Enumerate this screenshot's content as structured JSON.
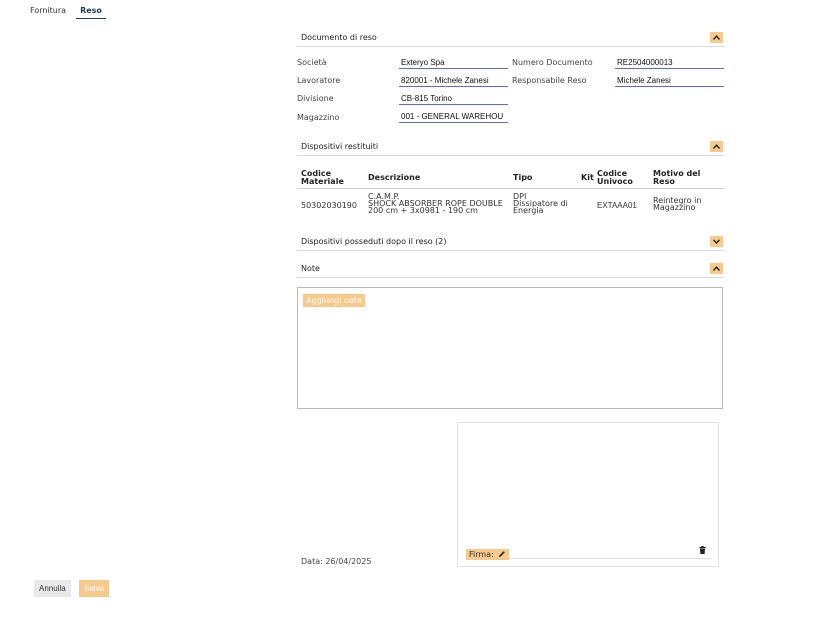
{
  "tabs": [
    {
      "label": "Fornitura",
      "active": false
    },
    {
      "label": "Reso",
      "active": true
    }
  ],
  "document": {
    "title": "Documento di reso",
    "fields": {
      "societa_label": "Società",
      "societa_value": "Exteryo Spa",
      "lavoratore_label": "Lavoratore",
      "lavoratore_value": "820001 - Michele Zanesi",
      "divisione_label": "Divisione",
      "divisione_value": "CB-815 Torino",
      "magazzino_label": "Magazzino",
      "magazzino_value": "001 - GENERAL WAREHOU",
      "numero_label": "Numero Documento",
      "numero_value": "RE2504000013",
      "responsabile_label": "Responsabile Reso",
      "responsabile_value": "Michele Zanesi"
    }
  },
  "returned": {
    "title": "Dispositivi restituiti",
    "headers": {
      "codice_materiale": [
        "Codice",
        "Materiale"
      ],
      "descrizione": "Descrizione",
      "tipo": "Tipo",
      "kit": "Kit",
      "codice_univoco": [
        "Codice",
        "Univoco"
      ],
      "motivo": [
        "Motivo del",
        "Reso"
      ]
    },
    "rows": [
      {
        "codice_materiale": "50302030190",
        "descrizione": [
          "C.A.M.P.",
          "SHOCK ABSORBER ROPE DOUBLE",
          "200 cm + 3x0981 - 190 cm"
        ],
        "tipo": [
          "DPI",
          "Dissipatore di",
          "Energia"
        ],
        "kit": "",
        "codice_univoco": "EXTAAA01",
        "motivo": [
          "Reintegro in",
          "Magazzino"
        ]
      }
    ]
  },
  "owned": {
    "title": "Dispositivi posseduti dopo il reso (2)"
  },
  "notes": {
    "title": "Note",
    "placeholder": "Aggiungi note"
  },
  "signature": {
    "date_text": "Data: 26/04/2025",
    "firma_label": "Firma:"
  },
  "footer": {
    "cancel_label": "Annulla",
    "save_label": "Salva"
  },
  "colors": {
    "accent": "#f7c98b",
    "underline": "#5b6bd0",
    "tab_active": "#1e3a5f"
  },
  "icons": {
    "collapse": "chevron-up-icon",
    "expand": "chevron-down-icon",
    "edit": "pencil-icon",
    "delete": "trash-icon"
  }
}
